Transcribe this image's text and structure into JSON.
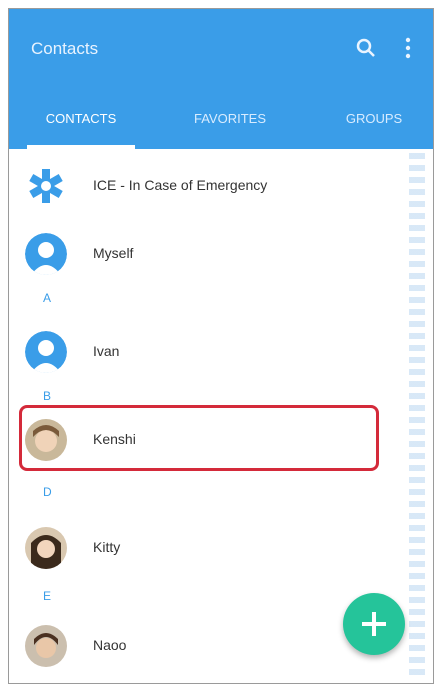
{
  "app": {
    "title": "Contacts"
  },
  "toolbar": {
    "search_icon": "search-icon",
    "more_icon": "more-vertical-icon"
  },
  "tabs": [
    {
      "label": "CONTACTS",
      "active": true
    },
    {
      "label": "FAVORITES",
      "active": false
    },
    {
      "label": "GROUPS",
      "active": false
    }
  ],
  "contacts": [
    {
      "name": "ICE - In Case of Emergency",
      "avatar": "ice-icon"
    },
    {
      "name": "Myself",
      "avatar": "default-avatar"
    },
    {
      "name": "Ivan",
      "avatar": "default-avatar"
    },
    {
      "name": "Kenshi",
      "avatar": "photo"
    },
    {
      "name": "Kitty",
      "avatar": "photo"
    },
    {
      "name": "Naoo",
      "avatar": "photo"
    }
  ],
  "section_letters": [
    "A",
    "B",
    "D",
    "E"
  ],
  "colors": {
    "accent": "#3a9de8",
    "fab": "#25c49a",
    "highlight": "#d42a3a"
  },
  "fab": {
    "icon": "plus-icon"
  }
}
